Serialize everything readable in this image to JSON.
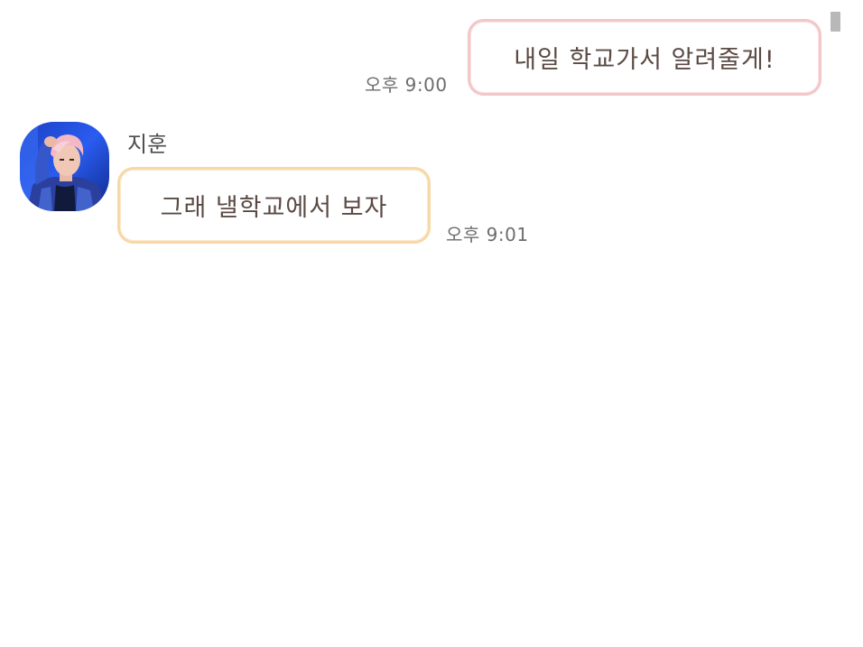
{
  "messages": [
    {
      "direction": "outgoing",
      "text": "내일 학교가서 알려줄게!",
      "time": "오후 9:00",
      "border_color": "#f3c6c9"
    },
    {
      "direction": "incoming",
      "sender": "지훈",
      "avatar_icon": "profile-photo",
      "text": "그래 낼학교에서 보자",
      "time": "오후 9:01",
      "border_color": "#f7d8a6"
    }
  ],
  "colors": {
    "background": "#ffffff",
    "text": "#5b4a44",
    "timestamp": "#6d6d6d",
    "scrollbar": "#b8b8b8"
  }
}
